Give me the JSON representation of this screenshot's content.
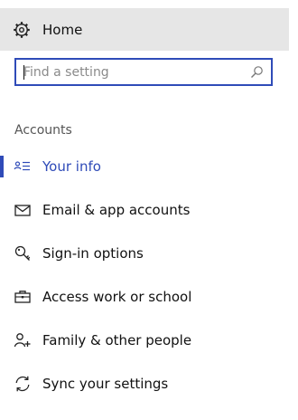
{
  "home": {
    "label": "Home",
    "icon": "gear-icon"
  },
  "search": {
    "placeholder": "Find a setting",
    "icon": "search-icon"
  },
  "section": {
    "title": "Accounts"
  },
  "nav": {
    "items": [
      {
        "label": "Your info",
        "icon": "contact-card-icon",
        "active": true
      },
      {
        "label": "Email & app accounts",
        "icon": "mail-icon"
      },
      {
        "label": "Sign-in options",
        "icon": "key-icon"
      },
      {
        "label": "Access work or school",
        "icon": "briefcase-icon"
      },
      {
        "label": "Family & other people",
        "icon": "add-person-icon"
      },
      {
        "label": "Sync your settings",
        "icon": "sync-icon"
      }
    ]
  },
  "colors": {
    "accent": "#2f4bb8",
    "home_bg": "#e6e6e6"
  }
}
